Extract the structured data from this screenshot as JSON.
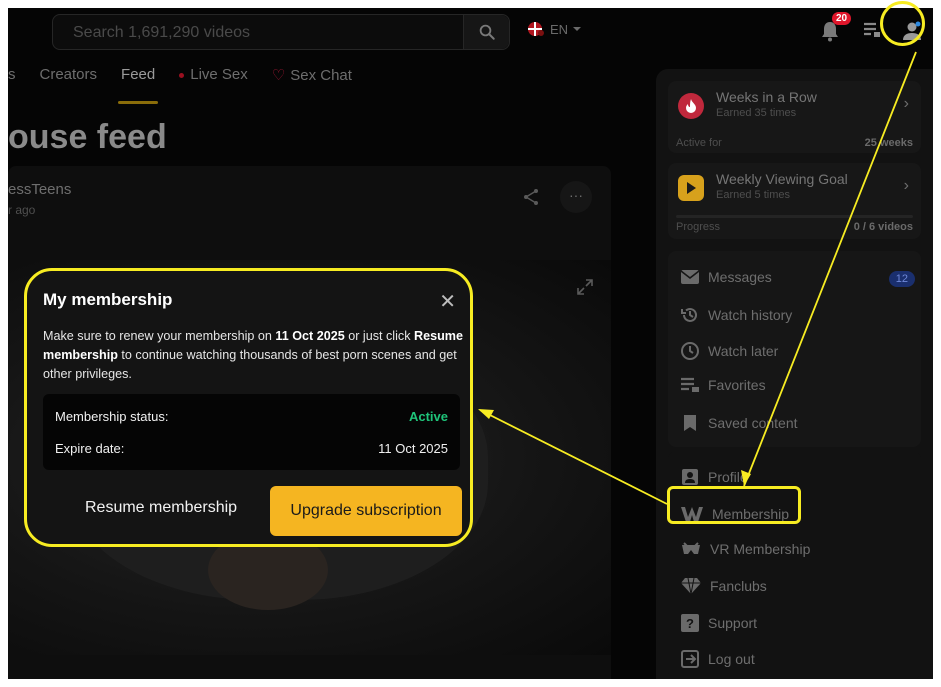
{
  "search": {
    "placeholder": "Search 1,691,290 videos"
  },
  "header": {
    "language": "EN",
    "notifications_count": "20"
  },
  "nav": {
    "tabs": [
      {
        "label": "s"
      },
      {
        "label": "Creators"
      },
      {
        "label": "Feed"
      },
      {
        "label": "Live Sex"
      },
      {
        "label": "Sex Chat"
      }
    ]
  },
  "feed": {
    "title": "ouse feed",
    "author": "essTeens",
    "time": "r ago"
  },
  "sidebar": {
    "cards": [
      {
        "title": "Weeks in a Row",
        "subtitle": "Earned 35 times",
        "foot_label": "Active for",
        "foot_value": "25 weeks",
        "icon": "flame-badge-icon",
        "color": "#c0283c"
      },
      {
        "title": "Weekly Viewing Goal",
        "subtitle": "Earned 5 times",
        "foot_label": "Progress",
        "foot_value": "0 / 6 videos",
        "progress": 0,
        "icon": "play-badge-icon",
        "color": "#d7a11c"
      }
    ],
    "menu": [
      {
        "label": "Messages",
        "badge": "12",
        "icon": "mail-icon"
      },
      {
        "label": "Watch history",
        "icon": "history-icon"
      },
      {
        "label": "Watch later",
        "icon": "clock-icon"
      },
      {
        "label": "Favorites",
        "icon": "playlist-icon"
      },
      {
        "label": "Saved content",
        "icon": "bookmark-icon"
      }
    ],
    "account": [
      {
        "label": "Profile",
        "icon": "profile-icon"
      },
      {
        "label": "Membership",
        "icon": "membership-icon"
      },
      {
        "label": "VR Membership",
        "icon": "vr-icon"
      },
      {
        "label": "Fanclubs",
        "icon": "diamond-icon"
      },
      {
        "label": "Support",
        "icon": "support-icon"
      },
      {
        "label": "Log out",
        "icon": "logout-icon"
      }
    ]
  },
  "modal": {
    "title": "My membership",
    "text": {
      "p1": "Make sure to renew your membership on ",
      "date": "11 Oct 2025",
      "p2": " or just click ",
      "resume": "Resume membership",
      "p3": " to continue watching thousands of best porn scenes and get other privileges."
    },
    "status_label": "Membership status:",
    "status_value": "Active",
    "expire_label": "Expire date:",
    "expire_value": "11 Oct 2025",
    "resume_button": "Resume membership",
    "upgrade_button": "Upgrade subscription"
  },
  "colors": {
    "accent": "#f5b521",
    "highlight": "#f7ec22",
    "active": "#1fc47a",
    "badge": "#e0162b"
  }
}
